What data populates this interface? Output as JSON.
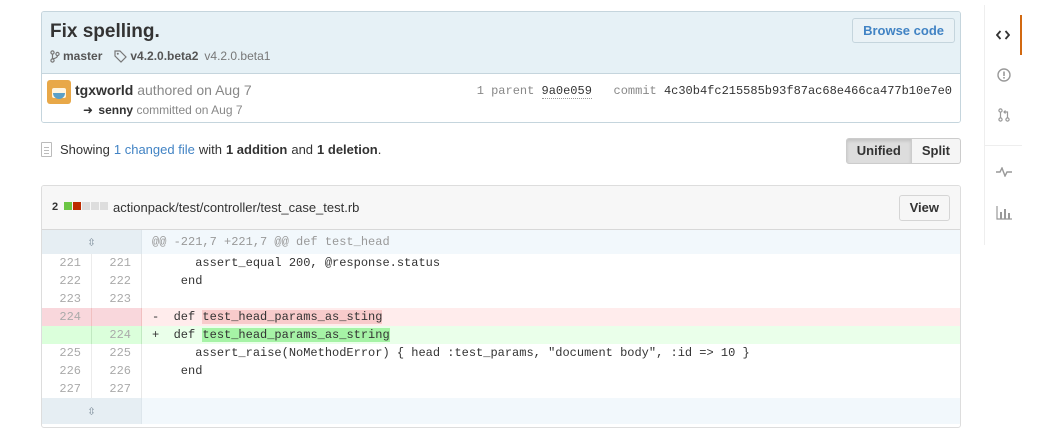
{
  "commit": {
    "title": "Fix spelling.",
    "browse_label": "Browse code",
    "branch": "master",
    "tag_primary": "v4.2.0.beta2",
    "tag_secondary": "v4.2.0.beta1",
    "author": "tgxworld",
    "authored_text": "authored on Aug 7",
    "committer": "senny",
    "committed_text": "committed on Aug 7",
    "parent_label": "1 parent",
    "parent_sha": "9a0e059",
    "commit_label": "commit",
    "commit_sha": "4c30b4fc215585b93f87ac68e466ca477b10e7e0"
  },
  "toolbar": {
    "showing": "Showing",
    "changed_files": "1 changed file",
    "with": "with",
    "additions": "1 addition",
    "and": "and",
    "deletions": "1 deletion",
    "period": ".",
    "unified": "Unified",
    "split": "Split"
  },
  "file": {
    "count": "2",
    "path": "actionpack/test/controller/test_case_test.rb",
    "view_label": "View",
    "bar_colors": [
      "#6cc644",
      "#bd2c00",
      "#dddddd",
      "#dddddd",
      "#dddddd"
    ]
  },
  "diff": {
    "hunk_header": "@@ -221,7 +221,7 @@ def test_head",
    "lines": [
      {
        "type": "ctx",
        "old": "221",
        "new": "221",
        "prefix": " ",
        "pre": "     assert_equal 200, @response.status",
        "hl": "",
        "post": ""
      },
      {
        "type": "ctx",
        "old": "222",
        "new": "222",
        "prefix": " ",
        "pre": "   end",
        "hl": "",
        "post": ""
      },
      {
        "type": "ctx",
        "old": "223",
        "new": "223",
        "prefix": " ",
        "pre": "",
        "hl": "",
        "post": ""
      },
      {
        "type": "del",
        "old": "224",
        "new": "",
        "prefix": "-",
        "pre": "  def ",
        "hl": "test_head_params_as_sting",
        "post": ""
      },
      {
        "type": "add",
        "old": "",
        "new": "224",
        "prefix": "+",
        "pre": "  def ",
        "hl": "test_head_params_as_string",
        "post": ""
      },
      {
        "type": "ctx",
        "old": "225",
        "new": "225",
        "prefix": " ",
        "pre": "     assert_raise(NoMethodError) { head :test_params, \"document body\", :id => 10 }",
        "hl": "",
        "post": ""
      },
      {
        "type": "ctx",
        "old": "226",
        "new": "226",
        "prefix": " ",
        "pre": "   end",
        "hl": "",
        "post": ""
      },
      {
        "type": "ctx",
        "old": "227",
        "new": "227",
        "prefix": " ",
        "pre": "",
        "hl": "",
        "post": ""
      }
    ]
  },
  "sidebar": {
    "items": [
      {
        "name": "code-icon",
        "glyph": "<>"
      },
      {
        "name": "issues-icon",
        "glyph": "!"
      },
      {
        "name": "pull-requests-icon",
        "glyph": "⇅"
      },
      {
        "name": "pulse-icon",
        "glyph": "∿"
      },
      {
        "name": "graphs-icon",
        "glyph": "▥"
      }
    ]
  }
}
